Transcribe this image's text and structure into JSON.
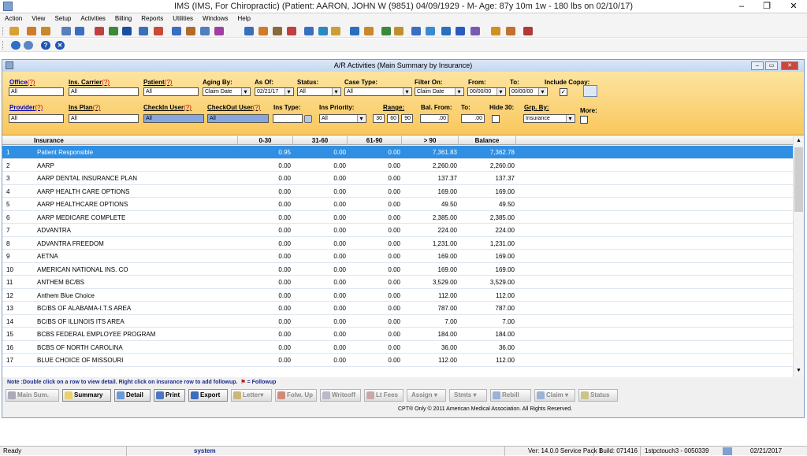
{
  "app": {
    "title": "IMS (IMS, For Chiropractic)    (Patient: AARON, JOHN W (9851) 04/09/1929 - M- Age: 87y 10m 1w - 180 lbs on 02/10/17)"
  },
  "menu": [
    "Action",
    "View",
    "Setup",
    "Activities",
    "Billing",
    "Reports",
    "Utilities",
    "Windows",
    "Help"
  ],
  "window": {
    "title": "A/R Activities  (Main Summary by Insurance)"
  },
  "filters": {
    "office_label": "Office",
    "office_value": "All",
    "ins_carrier_label": "Ins. Carrier",
    "ins_carrier_value": "All",
    "patient_label": "Patient",
    "patient_value": "All",
    "aging_by_label": "Aging By:",
    "aging_by_value": "Claim Date",
    "as_of_label": "As Of:",
    "as_of_value": "02/21/17",
    "status_label": "Status:",
    "status_value": "All",
    "case_type_label": "Case Type:",
    "case_type_value": "All",
    "filter_on_label": "Filter On:",
    "filter_on_value": "Claim Date",
    "from_label": "From:",
    "from_value": "00/00/00",
    "to_label": "To:",
    "to_value": "00/00/00",
    "include_copay_label": "Include Copay:",
    "provider_label": "Provider",
    "provider_value": "All",
    "ins_plan_label": "Ins Plan",
    "ins_plan_value": "All",
    "checkin_user_label": "CheckIn User",
    "checkin_user_value": "All",
    "checkout_user_label": "CheckOut User",
    "checkout_user_value": "All",
    "ins_type_label": "Ins Type:",
    "ins_type_value": "",
    "ins_priority_label": "Ins Priority:",
    "ins_priority_value": "All",
    "range_label": "Range:",
    "range_values": [
      "30",
      "60",
      "90"
    ],
    "bal_from_label": "Bal. From:",
    "bal_from_value": ".00",
    "bal_to_label": "To:",
    "bal_to_value": ".00",
    "hide30_label": "Hide 30:",
    "grp_by_label": "Grp. By:",
    "grp_by_value": "Insurance",
    "more_label": "More:",
    "q_mark": "(?)"
  },
  "grid": {
    "columns": [
      "Insurance",
      "0-30",
      "31-60",
      "61-90",
      "> 90",
      "Balance"
    ],
    "rows": [
      {
        "n": "1",
        "ins": "Patient Responsible",
        "c1": "0.95",
        "c2": "0.00",
        "c3": "0.00",
        "c4": "7,361.83",
        "bal": "7,362.78"
      },
      {
        "n": "2",
        "ins": "AARP",
        "c1": "0.00",
        "c2": "0.00",
        "c3": "0.00",
        "c4": "2,260.00",
        "bal": "2,260.00"
      },
      {
        "n": "3",
        "ins": "AARP DENTAL INSURANCE PLAN",
        "c1": "0.00",
        "c2": "0.00",
        "c3": "0.00",
        "c4": "137.37",
        "bal": "137.37"
      },
      {
        "n": "4",
        "ins": "AARP HEALTH CARE OPTIONS",
        "c1": "0.00",
        "c2": "0.00",
        "c3": "0.00",
        "c4": "169.00",
        "bal": "169.00"
      },
      {
        "n": "5",
        "ins": "AARP HEALTHCARE OPTIONS",
        "c1": "0.00",
        "c2": "0.00",
        "c3": "0.00",
        "c4": "49.50",
        "bal": "49.50"
      },
      {
        "n": "6",
        "ins": "AARP MEDICARE COMPLETE",
        "c1": "0.00",
        "c2": "0.00",
        "c3": "0.00",
        "c4": "2,385.00",
        "bal": "2,385.00"
      },
      {
        "n": "7",
        "ins": "ADVANTRA",
        "c1": "0.00",
        "c2": "0.00",
        "c3": "0.00",
        "c4": "224.00",
        "bal": "224.00"
      },
      {
        "n": "8",
        "ins": "ADVANTRA FREEDOM",
        "c1": "0.00",
        "c2": "0.00",
        "c3": "0.00",
        "c4": "1,231.00",
        "bal": "1,231.00"
      },
      {
        "n": "9",
        "ins": "AETNA",
        "c1": "0.00",
        "c2": "0.00",
        "c3": "0.00",
        "c4": "169.00",
        "bal": "169.00"
      },
      {
        "n": "10",
        "ins": "AMERICAN NATIONAL INS. CO",
        "c1": "0.00",
        "c2": "0.00",
        "c3": "0.00",
        "c4": "169.00",
        "bal": "169.00"
      },
      {
        "n": "11",
        "ins": "ANTHEM BC/BS",
        "c1": "0.00",
        "c2": "0.00",
        "c3": "0.00",
        "c4": "3,529.00",
        "bal": "3,529.00"
      },
      {
        "n": "12",
        "ins": "Anthem Blue Choice",
        "c1": "0.00",
        "c2": "0.00",
        "c3": "0.00",
        "c4": "112.00",
        "bal": "112.00"
      },
      {
        "n": "13",
        "ins": "BC/BS OF ALABAMA-I.T.S AREA",
        "c1": "0.00",
        "c2": "0.00",
        "c3": "0.00",
        "c4": "787.00",
        "bal": "787.00"
      },
      {
        "n": "14",
        "ins": "BC/BS OF ILLINOIS ITS AREA",
        "c1": "0.00",
        "c2": "0.00",
        "c3": "0.00",
        "c4": "7.00",
        "bal": "7.00"
      },
      {
        "n": "15",
        "ins": "BCBS FEDERAL EMPLOYEE PROGRAM",
        "c1": "0.00",
        "c2": "0.00",
        "c3": "0.00",
        "c4": "184.00",
        "bal": "184.00"
      },
      {
        "n": "16",
        "ins": "BCBS OF NORTH CAROLINA",
        "c1": "0.00",
        "c2": "0.00",
        "c3": "0.00",
        "c4": "36.00",
        "bal": "36.00"
      },
      {
        "n": "17",
        "ins": "BLUE CHOICE OF MISSOURI",
        "c1": "0.00",
        "c2": "0.00",
        "c3": "0.00",
        "c4": "112.00",
        "bal": "112.00"
      }
    ]
  },
  "note": {
    "text": "Note :Double click on a row to view detail. Right click on insurance row to add followup.",
    "flag_text": "= Followup"
  },
  "buttons": {
    "main_sum": "Main Sum.",
    "summary": "Summary",
    "detail": "Detail",
    "print": "Print",
    "export": "Export",
    "letter": "Letter",
    "folw_up": "Folw. Up",
    "writeoff": "Writeoff",
    "lt_fees": "Lt Fees",
    "assign": "Assign",
    "stmts": "Stmts",
    "rebill": "Rebill",
    "claim": "Claim",
    "status": "Status"
  },
  "copyright": "CPT® Only © 2011 American Medical Association.  All Rights Reserved.",
  "statusbar": {
    "ready": "Ready",
    "user": "system",
    "version": "Ver: 14.0.0 Service Pack 1",
    "build": "Build: 071416",
    "station": "1stpctouch3 - 0050339",
    "date": "02/21/2017"
  },
  "colors": {
    "filter_bg": "#f9c75c",
    "selected_row": "#2f8fe3",
    "note_text": "#1a2a8a"
  }
}
